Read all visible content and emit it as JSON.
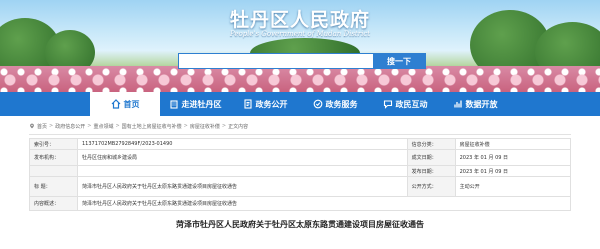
{
  "header": {
    "site_title": "牡丹区人民政府",
    "site_subtitle": "People's Government of Mudan District",
    "search": {
      "placeholder": "",
      "button_label": "搜一下"
    }
  },
  "nav": {
    "items": [
      {
        "label": "首页",
        "icon": "home-icon",
        "active": true
      },
      {
        "label": "走进牡丹区",
        "icon": "building-icon",
        "active": false
      },
      {
        "label": "政务公开",
        "icon": "document-icon",
        "active": false
      },
      {
        "label": "政务服务",
        "icon": "service-icon",
        "active": false
      },
      {
        "label": "政民互动",
        "icon": "chat-icon",
        "active": false
      },
      {
        "label": "数据开放",
        "icon": "data-icon",
        "active": false
      }
    ]
  },
  "breadcrumb": [
    "首页",
    "政府信息公开",
    "重点领域",
    "国有土地上房屋征收与补偿",
    "房屋征收补偿",
    "正文内容"
  ],
  "meta": {
    "index_no_label": "索引号：",
    "index_no": "11371702MB2792849F/2023-01490",
    "category_label": "信息分类：",
    "category": "房屋征收补偿",
    "publisher_label": "发布机构：",
    "publisher": "牡丹区住房和城乡建设局",
    "date_written_label": "成文日期：",
    "date_written": "2023 年 01 月 09 日",
    "date_published_label": "发布日期：",
    "date_published": "2023 年 01 月 09 日",
    "title_label": "标    题：",
    "title": "菏泽市牡丹区人民政府关于牡丹区太原东路贯通建设项目房屋征收通告",
    "disclosure_label": "公开方式：",
    "disclosure": "主动公开",
    "summary_label": "内容概述：",
    "summary": "菏泽市牡丹区人民政府关于牡丹区太原东路贯通建设项目房屋征收通告"
  },
  "article": {
    "title": "菏泽市牡丹区人民政府关于牡丹区太原东路贯通建设项目房屋征收通告"
  },
  "colors": {
    "primary": "#1f77cf",
    "search_button": "#2e7fd1"
  }
}
